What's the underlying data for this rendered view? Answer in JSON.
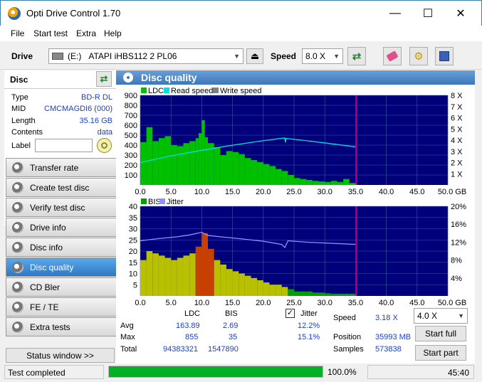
{
  "window": {
    "title": "Opti Drive Control 1.70",
    "minimize": "—",
    "maximize": "☐",
    "close": "✕"
  },
  "menu": [
    "File",
    "Start test",
    "Extra",
    "Help"
  ],
  "toolbar": {
    "drive_label": "Drive",
    "drive_letter": "(E:)",
    "drive_name": "ATAPI iHBS112   2 PL06",
    "speed_label": "Speed",
    "speed_value": "8.0 X"
  },
  "disc": {
    "header": "Disc",
    "rows": [
      {
        "label": "Type",
        "value": "BD-R DL"
      },
      {
        "label": "MID",
        "value": "CMCMAGDI6 (000)"
      },
      {
        "label": "Length",
        "value": "35.16 GB"
      },
      {
        "label": "Contents",
        "value": "data"
      }
    ],
    "label_field": "Label",
    "label_value": ""
  },
  "nav": [
    {
      "label": "Transfer rate",
      "active": false
    },
    {
      "label": "Create test disc",
      "active": false
    },
    {
      "label": "Verify test disc",
      "active": false
    },
    {
      "label": "Drive info",
      "active": false
    },
    {
      "label": "Disc info",
      "active": false
    },
    {
      "label": "Disc quality",
      "active": true
    },
    {
      "label": "CD Bler",
      "active": false
    },
    {
      "label": "FE / TE",
      "active": false
    },
    {
      "label": "Extra tests",
      "active": false
    }
  ],
  "status_window": "Status window >>",
  "panel_title": "Disc quality",
  "colors": {
    "ldc": "#00c000",
    "read": "#00e0e0",
    "write": "#808080",
    "bis": "#00a000",
    "jitter": "#9090ff",
    "plot_bg": "#00007a",
    "grid": "#3a5aa0",
    "marker": "#b00080"
  },
  "chart_data": [
    {
      "type": "area",
      "legend": [
        "LDC",
        "Read speed",
        "Write speed"
      ],
      "x_ticks": [
        "0.0",
        "5.0",
        "10.0",
        "15.0",
        "20.0",
        "25.0",
        "30.0",
        "35.0",
        "40.0",
        "45.0",
        "50.0 GB"
      ],
      "y_ticks_left": [
        "900",
        "800",
        "700",
        "600",
        "500",
        "400",
        "300",
        "200",
        "100"
      ],
      "y_ticks_right": [
        "8 X",
        "7 X",
        "6 X",
        "5 X",
        "4 X",
        "3 X",
        "2 X",
        "1 X"
      ],
      "xlim": [
        0,
        50
      ],
      "ylim": [
        0,
        900
      ],
      "y2lim": [
        0,
        8
      ],
      "marker_x": 35.16,
      "ldc": [
        [
          0,
          430
        ],
        [
          1,
          580
        ],
        [
          2,
          440
        ],
        [
          3,
          470
        ],
        [
          4,
          490
        ],
        [
          5,
          400
        ],
        [
          6,
          390
        ],
        [
          7,
          420
        ],
        [
          8,
          440
        ],
        [
          9,
          470
        ],
        [
          9.5,
          520
        ],
        [
          10,
          650
        ],
        [
          10.5,
          480
        ],
        [
          11,
          420
        ],
        [
          12,
          380
        ],
        [
          13,
          300
        ],
        [
          14,
          340
        ],
        [
          15,
          330
        ],
        [
          16,
          310
        ],
        [
          17,
          270
        ],
        [
          18,
          250
        ],
        [
          19,
          230
        ],
        [
          20,
          210
        ],
        [
          21,
          190
        ],
        [
          22,
          160
        ],
        [
          23,
          140
        ],
        [
          24,
          100
        ],
        [
          25,
          70
        ],
        [
          26,
          60
        ],
        [
          27,
          50
        ],
        [
          28,
          40
        ],
        [
          29,
          35
        ],
        [
          30,
          30
        ],
        [
          31,
          40
        ],
        [
          32,
          30
        ],
        [
          33,
          60
        ],
        [
          34,
          20
        ],
        [
          35,
          10
        ]
      ],
      "read_speed": [
        [
          0,
          2.0
        ],
        [
          5,
          2.6
        ],
        [
          10,
          3.1
        ],
        [
          15,
          3.55
        ],
        [
          20,
          3.95
        ],
        [
          23.5,
          4.2
        ],
        [
          23.6,
          3.8
        ],
        [
          23.7,
          4.15
        ],
        [
          27,
          3.95
        ],
        [
          30,
          3.75
        ],
        [
          35,
          3.4
        ]
      ]
    },
    {
      "type": "area",
      "legend": [
        "BIS",
        "Jitter"
      ],
      "x_ticks": [
        "0.0",
        "5.0",
        "10.0",
        "15.0",
        "20.0",
        "25.0",
        "30.0",
        "35.0",
        "40.0",
        "45.0",
        "50.0 GB"
      ],
      "y_ticks_left": [
        "40",
        "35",
        "30",
        "25",
        "20",
        "15",
        "10",
        "5"
      ],
      "y_ticks_right": [
        "20%",
        "16%",
        "12%",
        "8%",
        "4%"
      ],
      "xlim": [
        0,
        50
      ],
      "ylim": [
        0,
        40
      ],
      "y2lim": [
        0,
        20
      ],
      "marker_x": 35.16,
      "bis": [
        [
          0,
          16
        ],
        [
          1,
          20
        ],
        [
          2,
          19
        ],
        [
          3,
          18
        ],
        [
          4,
          17
        ],
        [
          5,
          16
        ],
        [
          6,
          17
        ],
        [
          7,
          18
        ],
        [
          8,
          19
        ],
        [
          9,
          22
        ],
        [
          10,
          28
        ],
        [
          11,
          21
        ],
        [
          12,
          16
        ],
        [
          13,
          14
        ],
        [
          14,
          12
        ],
        [
          15,
          11
        ],
        [
          16,
          10
        ],
        [
          17,
          9
        ],
        [
          18,
          8
        ],
        [
          19,
          7
        ],
        [
          20,
          6
        ],
        [
          21,
          5
        ],
        [
          22,
          5
        ],
        [
          23,
          4
        ],
        [
          24,
          3
        ],
        [
          25,
          2
        ],
        [
          26,
          2
        ],
        [
          27,
          2
        ],
        [
          28,
          1.5
        ],
        [
          29,
          1.5
        ],
        [
          30,
          1.2
        ],
        [
          31,
          1
        ],
        [
          32,
          1
        ],
        [
          33,
          1
        ],
        [
          34,
          1
        ],
        [
          35,
          0.5
        ]
      ],
      "jitter": [
        [
          0,
          12.3
        ],
        [
          3,
          12.8
        ],
        [
          6,
          13.2
        ],
        [
          8,
          13.6
        ],
        [
          10,
          14.2
        ],
        [
          11,
          13.5
        ],
        [
          13,
          13.2
        ],
        [
          16,
          12.8
        ],
        [
          20,
          12.2
        ],
        [
          23,
          11.5
        ],
        [
          23.5,
          10.8
        ],
        [
          24,
          12.3
        ],
        [
          27,
          12.0
        ],
        [
          30,
          11.8
        ],
        [
          35,
          11.5
        ]
      ]
    }
  ],
  "stats": {
    "col_ldc": "LDC",
    "col_bis": "BIS",
    "jitter_label": "Jitter",
    "jitter_checked": true,
    "rows": [
      {
        "name": "Avg",
        "ldc": "163.89",
        "bis": "2.69",
        "jitter": "12.2%"
      },
      {
        "name": "Max",
        "ldc": "855",
        "bis": "35",
        "jitter": "15.1%"
      },
      {
        "name": "Total",
        "ldc": "94383321",
        "bis": "1547890",
        "jitter": ""
      }
    ],
    "speed_label": "Speed",
    "speed_value": "3.18 X",
    "position_label": "Position",
    "position_value": "35993 MB",
    "samples_label": "Samples",
    "samples_value": "573838",
    "speed_select": "4.0 X",
    "start_full": "Start full",
    "start_part": "Start part"
  },
  "status": {
    "text": "Test completed",
    "progress": 1.0,
    "progress_text": "100.0%",
    "time": "45:40"
  }
}
